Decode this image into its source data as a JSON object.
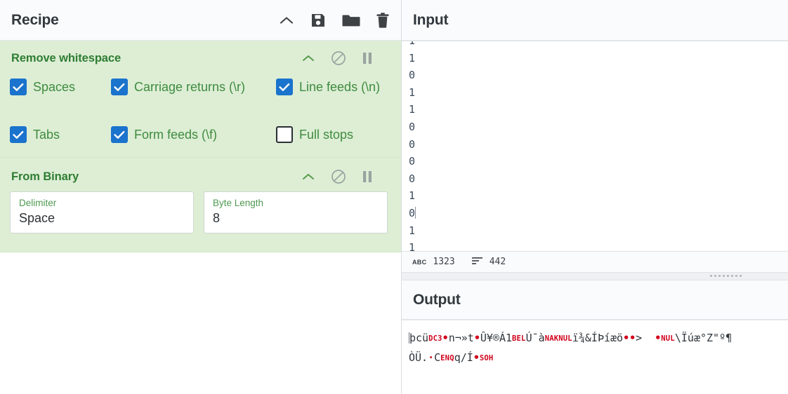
{
  "recipe": {
    "title": "Recipe",
    "controls": [
      {
        "name": "collapse-icon",
        "icon": "chevron-up-icon"
      },
      {
        "name": "save-recipe-button",
        "icon": "save-icon"
      },
      {
        "name": "load-recipe-button",
        "icon": "folder-icon"
      },
      {
        "name": "clear-recipe-button",
        "icon": "trash-icon"
      }
    ],
    "operations": [
      {
        "title": "Remove whitespace",
        "icons": [
          "chevron-up-icon",
          "disable-icon",
          "breakpoint-pause-icon"
        ],
        "checkbox_rows": [
          [
            {
              "label": "Spaces",
              "checked": true
            },
            {
              "label": "Carriage returns (\\r)",
              "checked": true
            },
            {
              "label": "Line feeds (\\n)",
              "checked": true
            }
          ],
          [
            {
              "label": "Tabs",
              "checked": true
            },
            {
              "label": "Form feeds (\\f)",
              "checked": true
            },
            {
              "label": "Full stops",
              "checked": false
            }
          ]
        ]
      },
      {
        "title": "From Binary",
        "icons": [
          "chevron-up-icon",
          "disable-icon",
          "breakpoint-pause-icon"
        ],
        "fields": [
          {
            "label": "Delimiter",
            "value": "Space"
          },
          {
            "label": "Byte Length",
            "value": "8"
          }
        ]
      }
    ]
  },
  "input": {
    "title": "Input",
    "lines": [
      "1",
      "1",
      "0",
      "1",
      "1",
      "0",
      "0",
      "0",
      "0",
      "1",
      "0",
      "1",
      "1"
    ],
    "caret_line_index": 10,
    "status": {
      "length_icon": "abc-icon",
      "length_label": "ABC",
      "length_value": "1323",
      "lines_icon": "lines-icon",
      "lines_value": "442"
    }
  },
  "output": {
    "title": "Output",
    "lines": [
      [
        {
          "t": "text",
          "v": "þcü"
        },
        {
          "t": "ctrl",
          "v": "DC3"
        },
        {
          "t": "dot",
          "v": "•"
        },
        {
          "t": "text",
          "v": "n¬»t"
        },
        {
          "t": "dot",
          "v": "•"
        },
        {
          "t": "text",
          "v": "Û¥®Á1"
        },
        {
          "t": "ctrl",
          "v": "BEL"
        },
        {
          "t": "text",
          "v": "Ú¯à"
        },
        {
          "t": "ctrl",
          "v": "NAK"
        },
        {
          "t": "ctrl",
          "v": "NUL"
        },
        {
          "t": "text",
          "v": "ï¾&ÍÞíæö"
        },
        {
          "t": "dot",
          "v": "••"
        },
        {
          "t": "text",
          "v": ">  "
        },
        {
          "t": "dot",
          "v": "•"
        },
        {
          "t": "ctrl",
          "v": "NUL"
        },
        {
          "t": "text",
          "v": "\\Ïúæ°Z\"º¶"
        }
      ],
      [
        {
          "t": "text",
          "v": "ÒÜ."
        },
        {
          "t": "dot",
          "v": "·"
        },
        {
          "t": "text",
          "v": "C"
        },
        {
          "t": "ctrl",
          "v": "ENQ"
        },
        {
          "t": "text",
          "v": "q/Í"
        },
        {
          "t": "dot",
          "v": "•"
        },
        {
          "t": "ctrl",
          "v": "SOH"
        }
      ]
    ]
  },
  "colors": {
    "op_background": "#ddeed5",
    "op_title": "#2f7d32",
    "checkbox_blue": "#1a73cc",
    "label_green": "#3f8b3f",
    "control_char_red": "#d0021b"
  }
}
